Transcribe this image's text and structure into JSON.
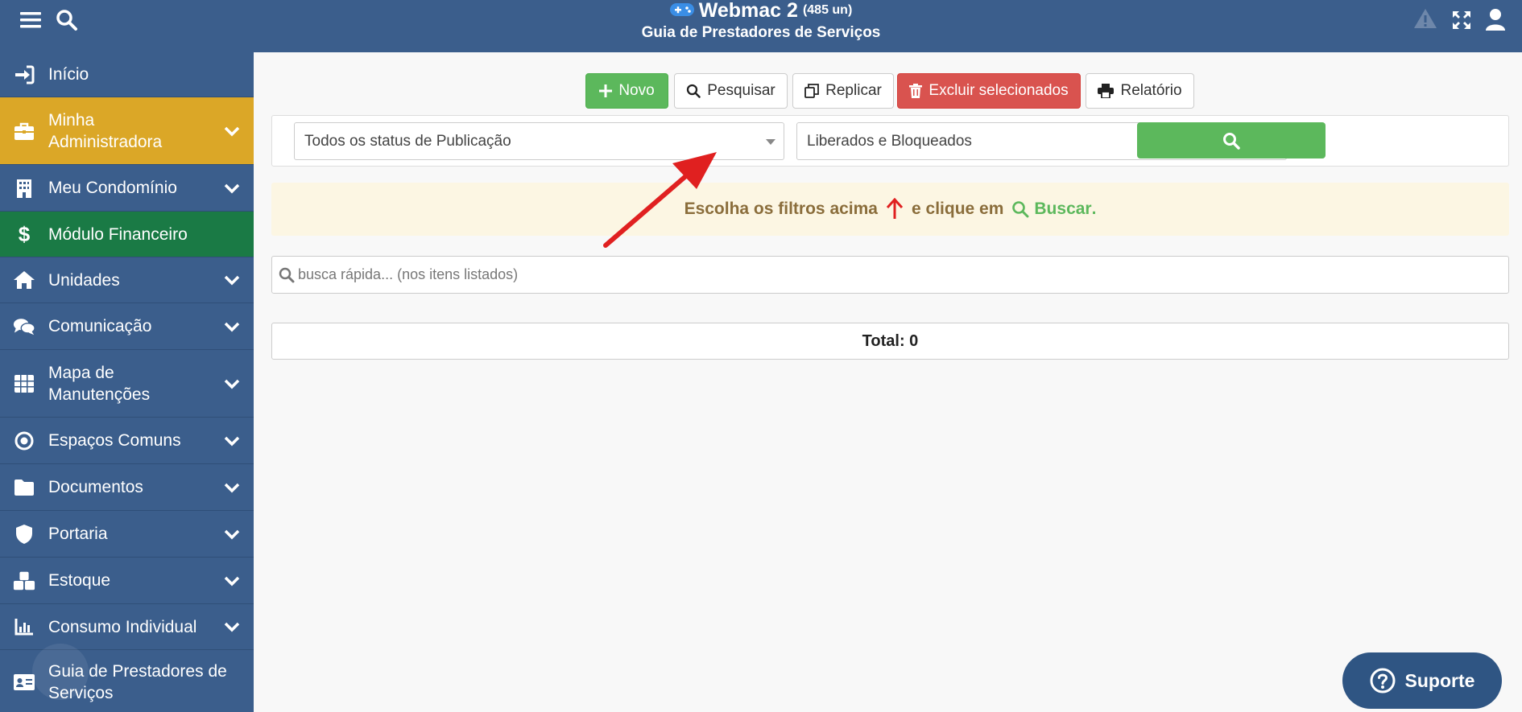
{
  "header": {
    "app_name": "Webmac 2",
    "unit_count": "(485 un)",
    "page_title": "Guia de Prestadores de Serviços"
  },
  "sidebar": {
    "items": [
      {
        "label": "Início",
        "icon": "sign-in-icon"
      },
      {
        "label": "Minha Administradora",
        "icon": "briefcase-icon"
      },
      {
        "label": "Meu Condomínio",
        "icon": "building-icon"
      },
      {
        "label": "Módulo Financeiro",
        "icon": "dollar-icon"
      },
      {
        "label": "Unidades",
        "icon": "home-icon"
      },
      {
        "label": "Comunicação",
        "icon": "comments-icon"
      },
      {
        "label": "Mapa de Manutenções",
        "icon": "grid-icon"
      },
      {
        "label": "Espaços Comuns",
        "icon": "circle-dot-icon"
      },
      {
        "label": "Documentos",
        "icon": "folder-icon"
      },
      {
        "label": "Portaria",
        "icon": "shield-icon"
      },
      {
        "label": "Estoque",
        "icon": "cubes-icon"
      },
      {
        "label": "Consumo Individual",
        "icon": "bar-chart-icon"
      },
      {
        "label": "Guia de Prestadores de Serviços",
        "icon": "id-card-icon"
      }
    ]
  },
  "toolbar": {
    "novo": "Novo",
    "pesquisar": "Pesquisar",
    "replicar": "Replicar",
    "excluir": "Excluir selecionados",
    "relatorio": "Relatório"
  },
  "filters": {
    "status_publicacao": "Todos os status de Publicação",
    "liberacao": "Liberados e Bloqueados"
  },
  "notice": {
    "text_before": "Escolha os filtros acima",
    "text_middle": "e clique em",
    "buscar": "Buscar",
    "period": "."
  },
  "quick_search": {
    "placeholder": "busca rápida... (nos itens listados)"
  },
  "total": {
    "label": "Total: 0"
  },
  "support": {
    "label": "Suporte"
  },
  "colors": {
    "navy": "#3b5e8c",
    "active_yellow": "#dba727",
    "finance_green": "#1a7a45",
    "success": "#5cb85c",
    "danger": "#d9534f",
    "notice_bg": "#fcf6e3",
    "notice_text": "#8a6d3b",
    "annotation_arrow": "#e02020"
  }
}
